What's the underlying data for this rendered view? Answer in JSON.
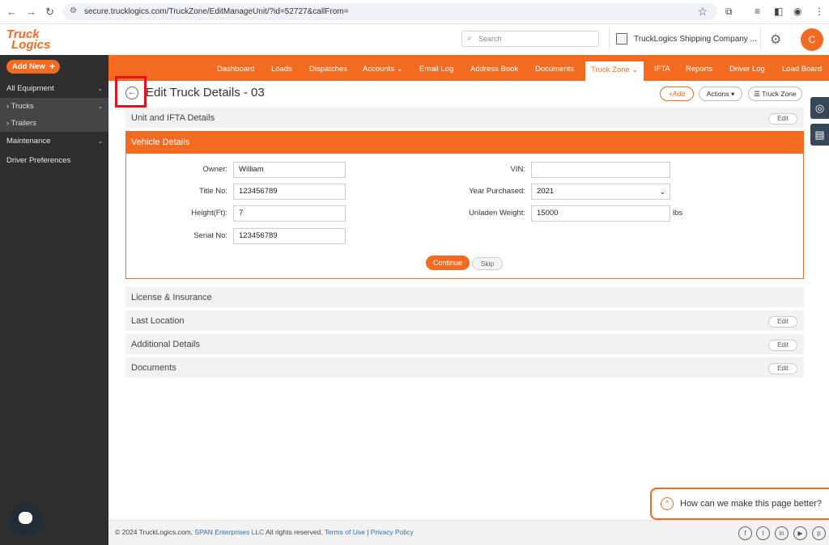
{
  "browser": {
    "url": "secure.trucklogics.com/TruckZone/EditManageUnit/?id=52727&callFrom="
  },
  "header": {
    "logo_line1": "Truck",
    "logo_line2": "Logics",
    "search_placeholder": "Search",
    "company_name": "TruckLogics Shipping Company ...",
    "avatar_initial": "C"
  },
  "sidebar": {
    "add_new": "Add New",
    "items": [
      {
        "label": "All Equipment"
      },
      {
        "label": "› Trucks"
      },
      {
        "label": "› Trailers"
      },
      {
        "label": "Maintenance"
      },
      {
        "label": "Driver Preferences"
      }
    ]
  },
  "topnav": {
    "items": [
      {
        "label": "Dashboard"
      },
      {
        "label": "Loads"
      },
      {
        "label": "Dispatches"
      },
      {
        "label": "Accounts ⌄"
      },
      {
        "label": "Email Log"
      },
      {
        "label": "Address Book"
      },
      {
        "label": "Documents"
      },
      {
        "label": "Truck Zone ⌄"
      },
      {
        "label": "IFTA"
      },
      {
        "label": "Reports"
      },
      {
        "label": "Driver Log"
      },
      {
        "label": "Load Board"
      }
    ]
  },
  "page": {
    "title": "Edit Truck Details - 03",
    "add_label": "+Add",
    "actions_label": "Actions ▾",
    "truck_zone_label": "Truck Zone"
  },
  "sections": {
    "unit_ifta": "Unit and IFTA Details",
    "vehicle_details": "Vehicle Details",
    "license": "License & Insurance",
    "last_location": "Last Location",
    "additional": "Additional Details",
    "documents": "Documents",
    "edit_label": "Edit"
  },
  "vehicle_form": {
    "owner_label": "Owner:",
    "owner_value": "William",
    "title_label": "Title No:",
    "title_value": "123456789",
    "height_label": "Height(Ft):",
    "height_value": "7",
    "serial_label": "Serial No:",
    "serial_value": "123456789",
    "vin_label": "VIN:",
    "vin_value": "",
    "year_label": "Year Purchased:",
    "year_value": "2021",
    "weight_label": "Unladen Weight:",
    "weight_value": "15000",
    "weight_unit": "lbs",
    "continue_label": "Continue",
    "skip_label": "Skip"
  },
  "feedback": {
    "text": "How can we make this page better?"
  },
  "footer": {
    "copyright": "© 2024 TruckLogics.com,",
    "company_link": "SPAN Enterprises LLC",
    "rights": "All rights reserved.",
    "terms": "Terms of Use",
    "sep": "|",
    "privacy": "Privacy Policy"
  },
  "colors": {
    "brand_orange": "#f26b21",
    "sidebar_dark": "#2f2f2f",
    "highlight_red": "#e3121d"
  }
}
